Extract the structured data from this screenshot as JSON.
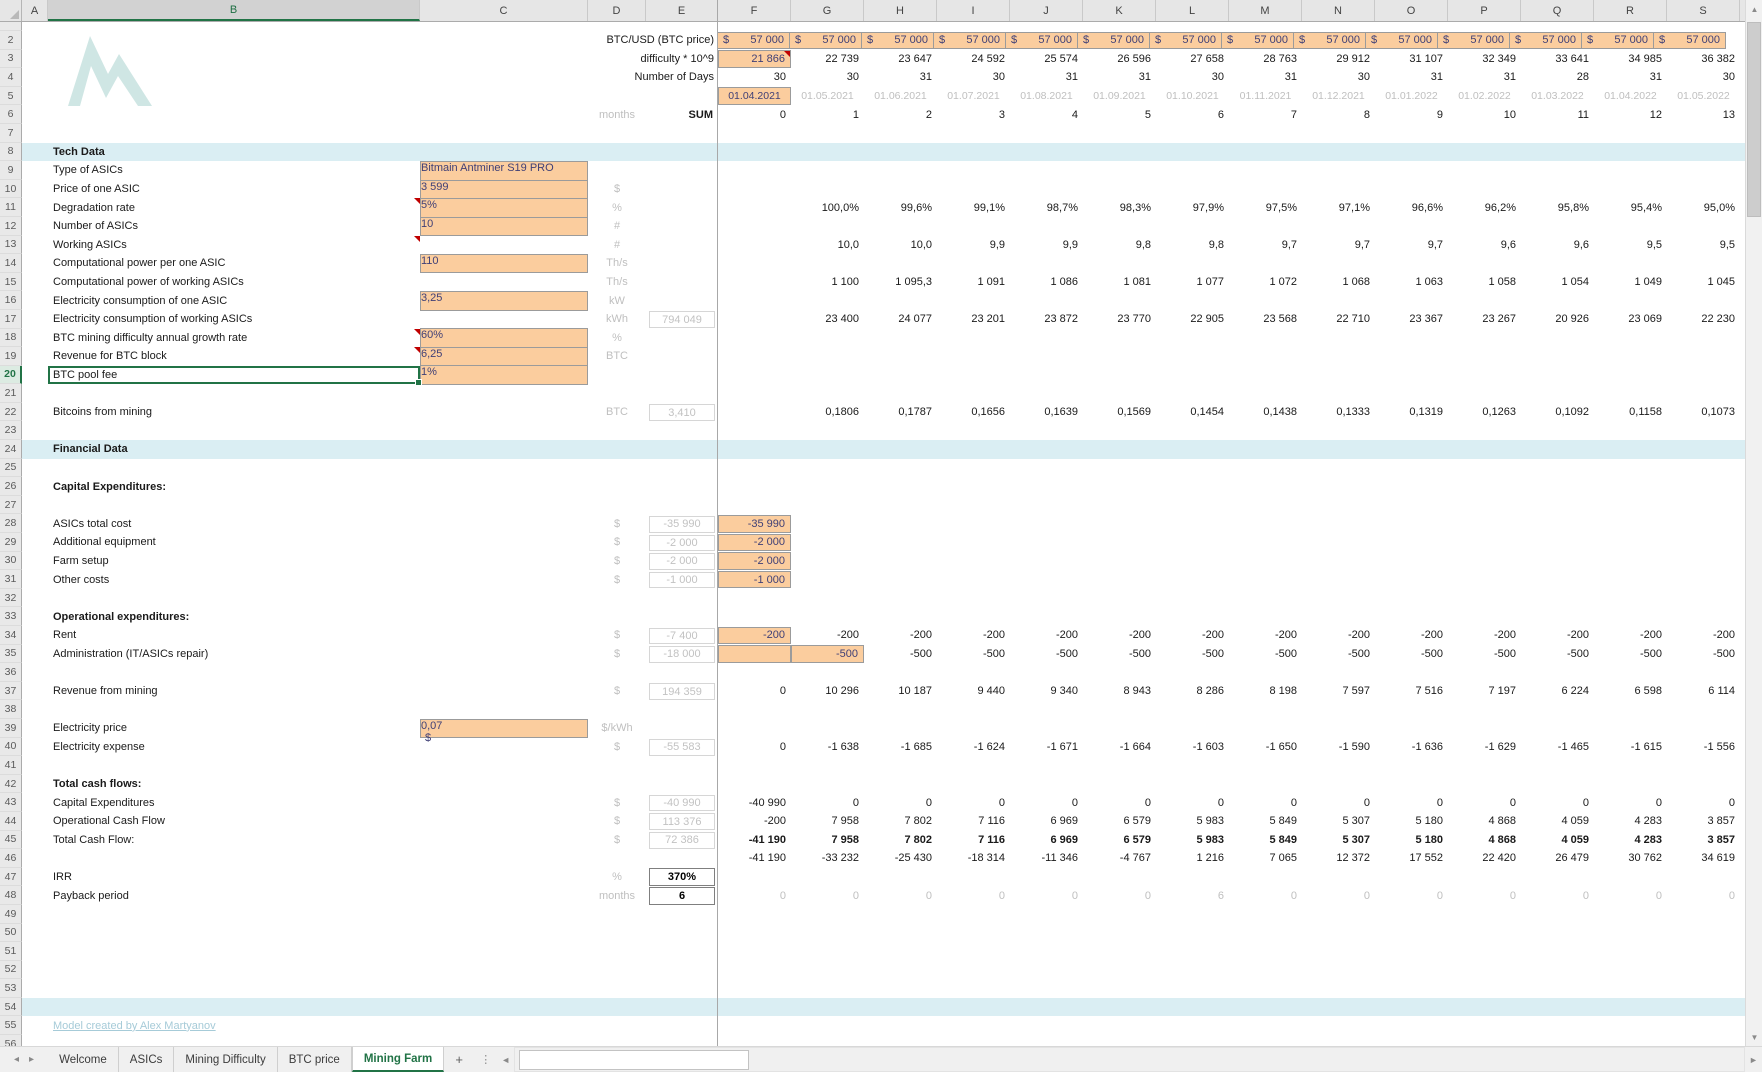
{
  "colors": {
    "accent": "#217346",
    "input_bg": "#fbcd9e",
    "input_text": "#3f3f76",
    "band": "#daeef3",
    "link": "#a6cbd8",
    "gray_text": "#bfbfbf"
  },
  "sheet": {
    "columns": [
      "A",
      "B",
      "C",
      "D",
      "E",
      "F",
      "G",
      "H",
      "I",
      "J",
      "K",
      "L",
      "M",
      "N",
      "O",
      "P",
      "Q",
      "R",
      "S"
    ],
    "rows": [
      {
        "n": 2,
        "rlabel": "BTC/USD (BTC price)",
        "money": true,
        "currency": "$",
        "cells": [
          "57 000",
          "57 000",
          "57 000",
          "57 000",
          "57 000",
          "57 000",
          "57 000",
          "57 000",
          "57 000",
          "57 000",
          "57 000",
          "57 000",
          "57 000",
          "57 000"
        ]
      },
      {
        "n": 3,
        "rlabel": "difficulty * 10^9",
        "orange": [
          0
        ],
        "comment_f": true,
        "cells": [
          "21 866",
          "22 739",
          "23 647",
          "24 592",
          "25 574",
          "26 596",
          "27 658",
          "28 763",
          "29 912",
          "31 107",
          "32 349",
          "33 641",
          "34 985",
          "36 382"
        ]
      },
      {
        "n": 4,
        "rlabel": "Number of Days",
        "cells": [
          "30",
          "30",
          "31",
          "30",
          "31",
          "31",
          "30",
          "31",
          "30",
          "31",
          "31",
          "28",
          "31",
          "30"
        ]
      },
      {
        "n": 5,
        "dates": true,
        "orange": [
          0
        ],
        "cells": [
          "01.04.2021",
          "01.05.2021",
          "01.06.2021",
          "01.07.2021",
          "01.08.2021",
          "01.09.2021",
          "01.10.2021",
          "01.11.2021",
          "01.12.2021",
          "01.01.2022",
          "01.02.2022",
          "01.03.2022",
          "01.04.2022",
          "01.05.2022"
        ]
      },
      {
        "n": 6,
        "d": "months",
        "e_sum": "SUM",
        "cells": [
          "0",
          "1",
          "2",
          "3",
          "4",
          "5",
          "6",
          "7",
          "8",
          "9",
          "10",
          "11",
          "12",
          "13"
        ]
      },
      {
        "n": 8,
        "band": true,
        "label": "Tech Data",
        "label_bold": true
      },
      {
        "n": 9,
        "label": "Type of ASICs",
        "input": "Bitmain Antminer S19 PRO",
        "input_center": true
      },
      {
        "n": 10,
        "label": "Price of one ASIC",
        "input": "3 599",
        "d": "$"
      },
      {
        "n": 11,
        "label": "Degradation rate",
        "input": "5%",
        "d": "%",
        "comment_b": true,
        "cells": [
          "",
          "100,0%",
          "99,6%",
          "99,1%",
          "98,7%",
          "98,3%",
          "97,9%",
          "97,5%",
          "97,1%",
          "96,6%",
          "96,2%",
          "95,8%",
          "95,4%",
          "95,0%"
        ]
      },
      {
        "n": 12,
        "label": "Number of ASICs",
        "input": "10",
        "d": "#"
      },
      {
        "n": 13,
        "label": "Working ASICs",
        "d": "#",
        "comment_b": true,
        "cells": [
          "",
          "10,0",
          "10,0",
          "9,9",
          "9,9",
          "9,8",
          "9,8",
          "9,7",
          "9,7",
          "9,7",
          "9,6",
          "9,6",
          "9,5",
          "9,5"
        ]
      },
      {
        "n": 14,
        "label": "Computational power per one ASIC",
        "input": "110",
        "d": "Th/s"
      },
      {
        "n": 15,
        "label": "Computational power of working ASICs",
        "d": "Th/s",
        "cells": [
          "",
          "1 100",
          "1 095,3",
          "1 091",
          "1 086",
          "1 081",
          "1 077",
          "1 072",
          "1 068",
          "1 063",
          "1 058",
          "1 054",
          "1 049",
          "1 045"
        ]
      },
      {
        "n": 16,
        "label": "Electricity consumption of one ASIC",
        "input": "3,25",
        "d": "kW"
      },
      {
        "n": 17,
        "label": "Electricity consumption of working ASICs",
        "d": "kWh",
        "ebox": "794 049",
        "cells": [
          "",
          "23 400",
          "24 077",
          "23 201",
          "23 872",
          "23 770",
          "22 905",
          "23 568",
          "22 710",
          "23 367",
          "23 267",
          "20 926",
          "23 069",
          "22 230"
        ]
      },
      {
        "n": 18,
        "label": "BTC mining difficulty annual growth rate",
        "input": "60%",
        "d": "%",
        "comment_b": true
      },
      {
        "n": 19,
        "label": "Revenue for BTC block",
        "input": "6,25",
        "d": "BTC",
        "comment_b": true
      },
      {
        "n": 20,
        "label": "BTC pool fee",
        "input": "1%",
        "selected": true
      },
      {
        "n": 22,
        "label": "Bitcoins from mining",
        "d": "BTC",
        "ebox": "3,410",
        "cells": [
          "",
          "0,1806",
          "0,1787",
          "0,1656",
          "0,1639",
          "0,1569",
          "0,1454",
          "0,1438",
          "0,1333",
          "0,1319",
          "0,1263",
          "0,1092",
          "0,1158",
          "0,1073"
        ]
      },
      {
        "n": 24,
        "band": true,
        "label": "Financial Data",
        "label_bold": true
      },
      {
        "n": 26,
        "label": "Capital Expenditures:",
        "label_bold": true
      },
      {
        "n": 28,
        "label": "ASICs total cost",
        "d": "$",
        "ebox": "-35 990",
        "orange": [
          0
        ],
        "cells": [
          "-35 990",
          "",
          "",
          "",
          "",
          "",
          "",
          "",
          "",
          "",
          "",
          "",
          "",
          ""
        ]
      },
      {
        "n": 29,
        "label": "Additional equipment",
        "d": "$",
        "ebox": "-2 000",
        "orange": [
          0
        ],
        "cells": [
          "-2 000",
          "",
          "",
          "",
          "",
          "",
          "",
          "",
          "",
          "",
          "",
          "",
          "",
          ""
        ]
      },
      {
        "n": 30,
        "label": "Farm setup",
        "d": "$",
        "ebox": "-2 000",
        "orange": [
          0
        ],
        "cells": [
          "-2 000",
          "",
          "",
          "",
          "",
          "",
          "",
          "",
          "",
          "",
          "",
          "",
          "",
          ""
        ]
      },
      {
        "n": 31,
        "label": "Other costs",
        "d": "$",
        "ebox": "-1 000",
        "orange": [
          0
        ],
        "cells": [
          "-1 000",
          "",
          "",
          "",
          "",
          "",
          "",
          "",
          "",
          "",
          "",
          "",
          "",
          ""
        ]
      },
      {
        "n": 33,
        "label": "Operational expenditures:",
        "label_bold": true
      },
      {
        "n": 34,
        "label": "Rent",
        "d": "$",
        "ebox": "-7 400",
        "orange": [
          0
        ],
        "cells": [
          "-200",
          "-200",
          "-200",
          "-200",
          "-200",
          "-200",
          "-200",
          "-200",
          "-200",
          "-200",
          "-200",
          "-200",
          "-200",
          "-200"
        ]
      },
      {
        "n": 35,
        "label": "Administration (IT/ASICs repair)",
        "d": "$",
        "ebox": "-18 000",
        "orange": [
          0,
          1
        ],
        "cells": [
          "",
          "-500",
          "-500",
          "-500",
          "-500",
          "-500",
          "-500",
          "-500",
          "-500",
          "-500",
          "-500",
          "-500",
          "-500",
          "-500"
        ]
      },
      {
        "n": 37,
        "label": "Revenue from mining",
        "d": "$",
        "ebox": "194 359",
        "cells": [
          "0",
          "10 296",
          "10 187",
          "9 440",
          "9 340",
          "8 943",
          "8 286",
          "8 198",
          "7 597",
          "7 516",
          "7 197",
          "6 224",
          "6 598",
          "6 114"
        ]
      },
      {
        "n": 39,
        "label": "Electricity price",
        "input": "0,07",
        "input_prefix": "$",
        "d": "$/kWh"
      },
      {
        "n": 40,
        "label": "Electricity expense",
        "d": "$",
        "ebox": "-55 583",
        "cells": [
          "0",
          "-1 638",
          "-1 685",
          "-1 624",
          "-1 671",
          "-1 664",
          "-1 603",
          "-1 650",
          "-1 590",
          "-1 636",
          "-1 629",
          "-1 465",
          "-1 615",
          "-1 556"
        ]
      },
      {
        "n": 42,
        "label": "Total cash flows:",
        "label_bold": true
      },
      {
        "n": 43,
        "label": "Capital Expenditures",
        "d": "$",
        "ebox": "-40 990",
        "cells": [
          "-40 990",
          "0",
          "0",
          "0",
          "0",
          "0",
          "0",
          "0",
          "0",
          "0",
          "0",
          "0",
          "0",
          "0"
        ]
      },
      {
        "n": 44,
        "label": "Operational Cash Flow",
        "d": "$",
        "ebox": "113 376",
        "cells": [
          "-200",
          "7 958",
          "7 802",
          "7 116",
          "6 969",
          "6 579",
          "5 983",
          "5 849",
          "5 307",
          "5 180",
          "4 868",
          "4 059",
          "4 283",
          "3 857"
        ]
      },
      {
        "n": 45,
        "label": "Total Cash Flow:",
        "d": "$",
        "ebox": "72 386",
        "cells_bold": true,
        "cells": [
          "-41 190",
          "7 958",
          "7 802",
          "7 116",
          "6 969",
          "6 579",
          "5 983",
          "5 849",
          "5 307",
          "5 180",
          "4 868",
          "4 059",
          "4 283",
          "3 857"
        ]
      },
      {
        "n": 46,
        "cells": [
          "-41 190",
          "-33 232",
          "-25 430",
          "-18 314",
          "-11 346",
          "-4 767",
          "1 216",
          "7 065",
          "12 372",
          "17 552",
          "22 420",
          "26 479",
          "30 762",
          "34 619"
        ]
      },
      {
        "n": 47,
        "label": "IRR",
        "d": "%",
        "result": "370%"
      },
      {
        "n": 48,
        "label": "Payback period",
        "d": "months",
        "result": "6",
        "cells_gray": true,
        "cells": [
          "0",
          "0",
          "0",
          "0",
          "0",
          "0",
          "6",
          "0",
          "0",
          "0",
          "0",
          "0",
          "0",
          "0"
        ]
      },
      {
        "n": 54,
        "band": true
      },
      {
        "n": 55,
        "link": "Model created by Alex Martyanov"
      }
    ]
  },
  "tabbar": {
    "tabs": [
      {
        "label": "Welcome",
        "active": false
      },
      {
        "label": "ASICs",
        "active": false
      },
      {
        "label": "Mining Difficulty",
        "active": false
      },
      {
        "label": "BTC price",
        "active": false
      },
      {
        "label": "Mining Farm",
        "active": true
      }
    ],
    "add_label": "+",
    "nav_left": "◂",
    "nav_right": "▸",
    "hscroll_left": "◄",
    "hscroll_right": "►",
    "kebab": "⋮"
  },
  "vscroll": {
    "up": "▲",
    "down": "▼"
  }
}
